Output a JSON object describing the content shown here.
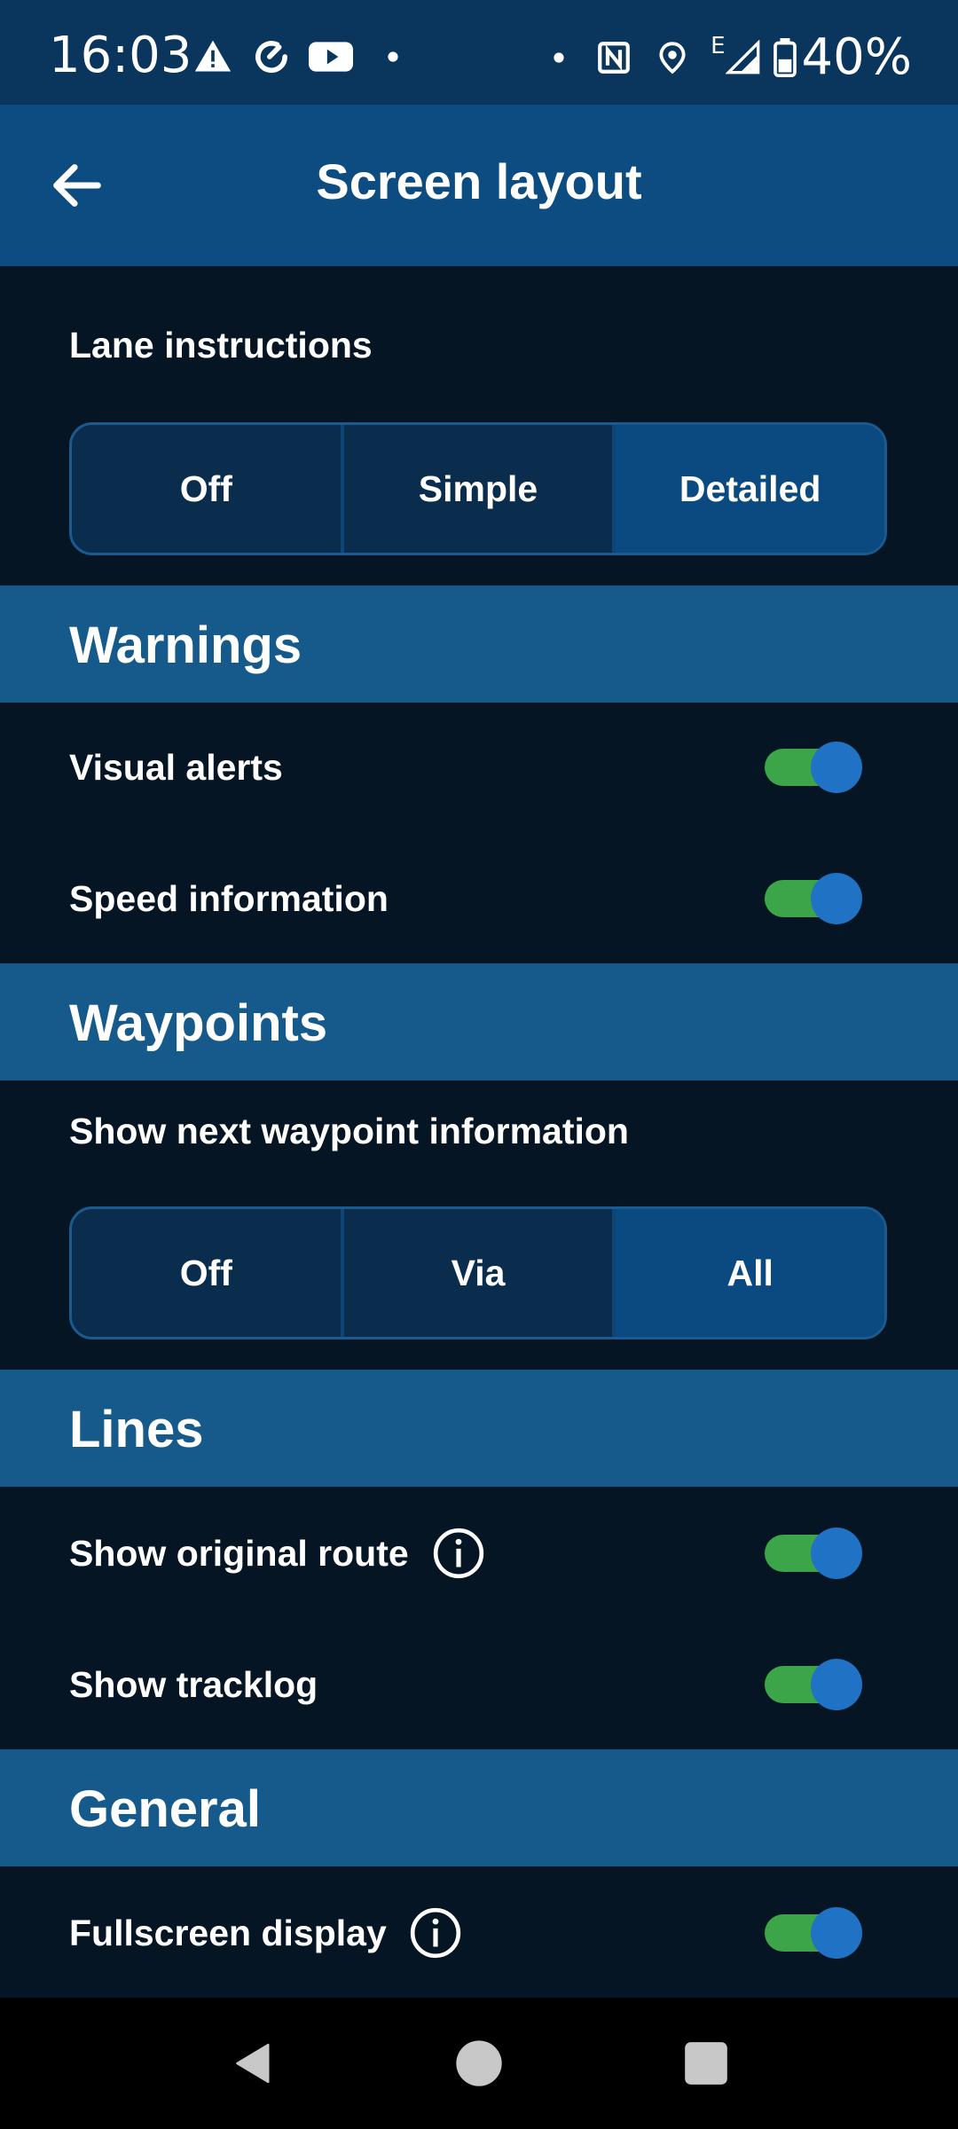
{
  "status_bar": {
    "time": "16:03",
    "battery": "40%",
    "network_type": "E",
    "left_icons": [
      "warning-icon",
      "sync-icon",
      "youtube-icon",
      "dot-icon"
    ],
    "right_icons": [
      "dot-icon",
      "nfc-icon",
      "location-icon",
      "signal-icon",
      "battery-icon"
    ]
  },
  "app_bar": {
    "title": "Screen layout",
    "back_icon": "arrow-back-icon"
  },
  "lane_instructions": {
    "label": "Lane instructions",
    "options": [
      "Off",
      "Simple",
      "Detailed"
    ],
    "selected": "Detailed"
  },
  "warnings": {
    "header": "Warnings",
    "visual_alerts": {
      "label": "Visual alerts",
      "on": true
    },
    "speed_information": {
      "label": "Speed information",
      "on": true
    }
  },
  "waypoints": {
    "header": "Waypoints",
    "label": "Show next waypoint information",
    "options": [
      "Off",
      "Via",
      "All"
    ],
    "selected": "All"
  },
  "lines": {
    "header": "Lines",
    "show_original_route": {
      "label": "Show original route",
      "on": true,
      "info_icon": "info-icon"
    },
    "show_tracklog": {
      "label": "Show tracklog",
      "on": true
    }
  },
  "general": {
    "header": "General",
    "fullscreen_display": {
      "label": "Fullscreen display",
      "on": true,
      "info_icon": "info-icon"
    }
  },
  "nav_bar": {
    "icons": [
      "back-triangle-icon",
      "home-circle-icon",
      "recents-square-icon"
    ]
  },
  "colors": {
    "status_bar": "#0a355c",
    "app_bar": "#0d4c80",
    "section_header": "#165a8b",
    "background": "#061524",
    "toggle_track": "#3ca54a",
    "toggle_thumb": "#1f72c4"
  }
}
